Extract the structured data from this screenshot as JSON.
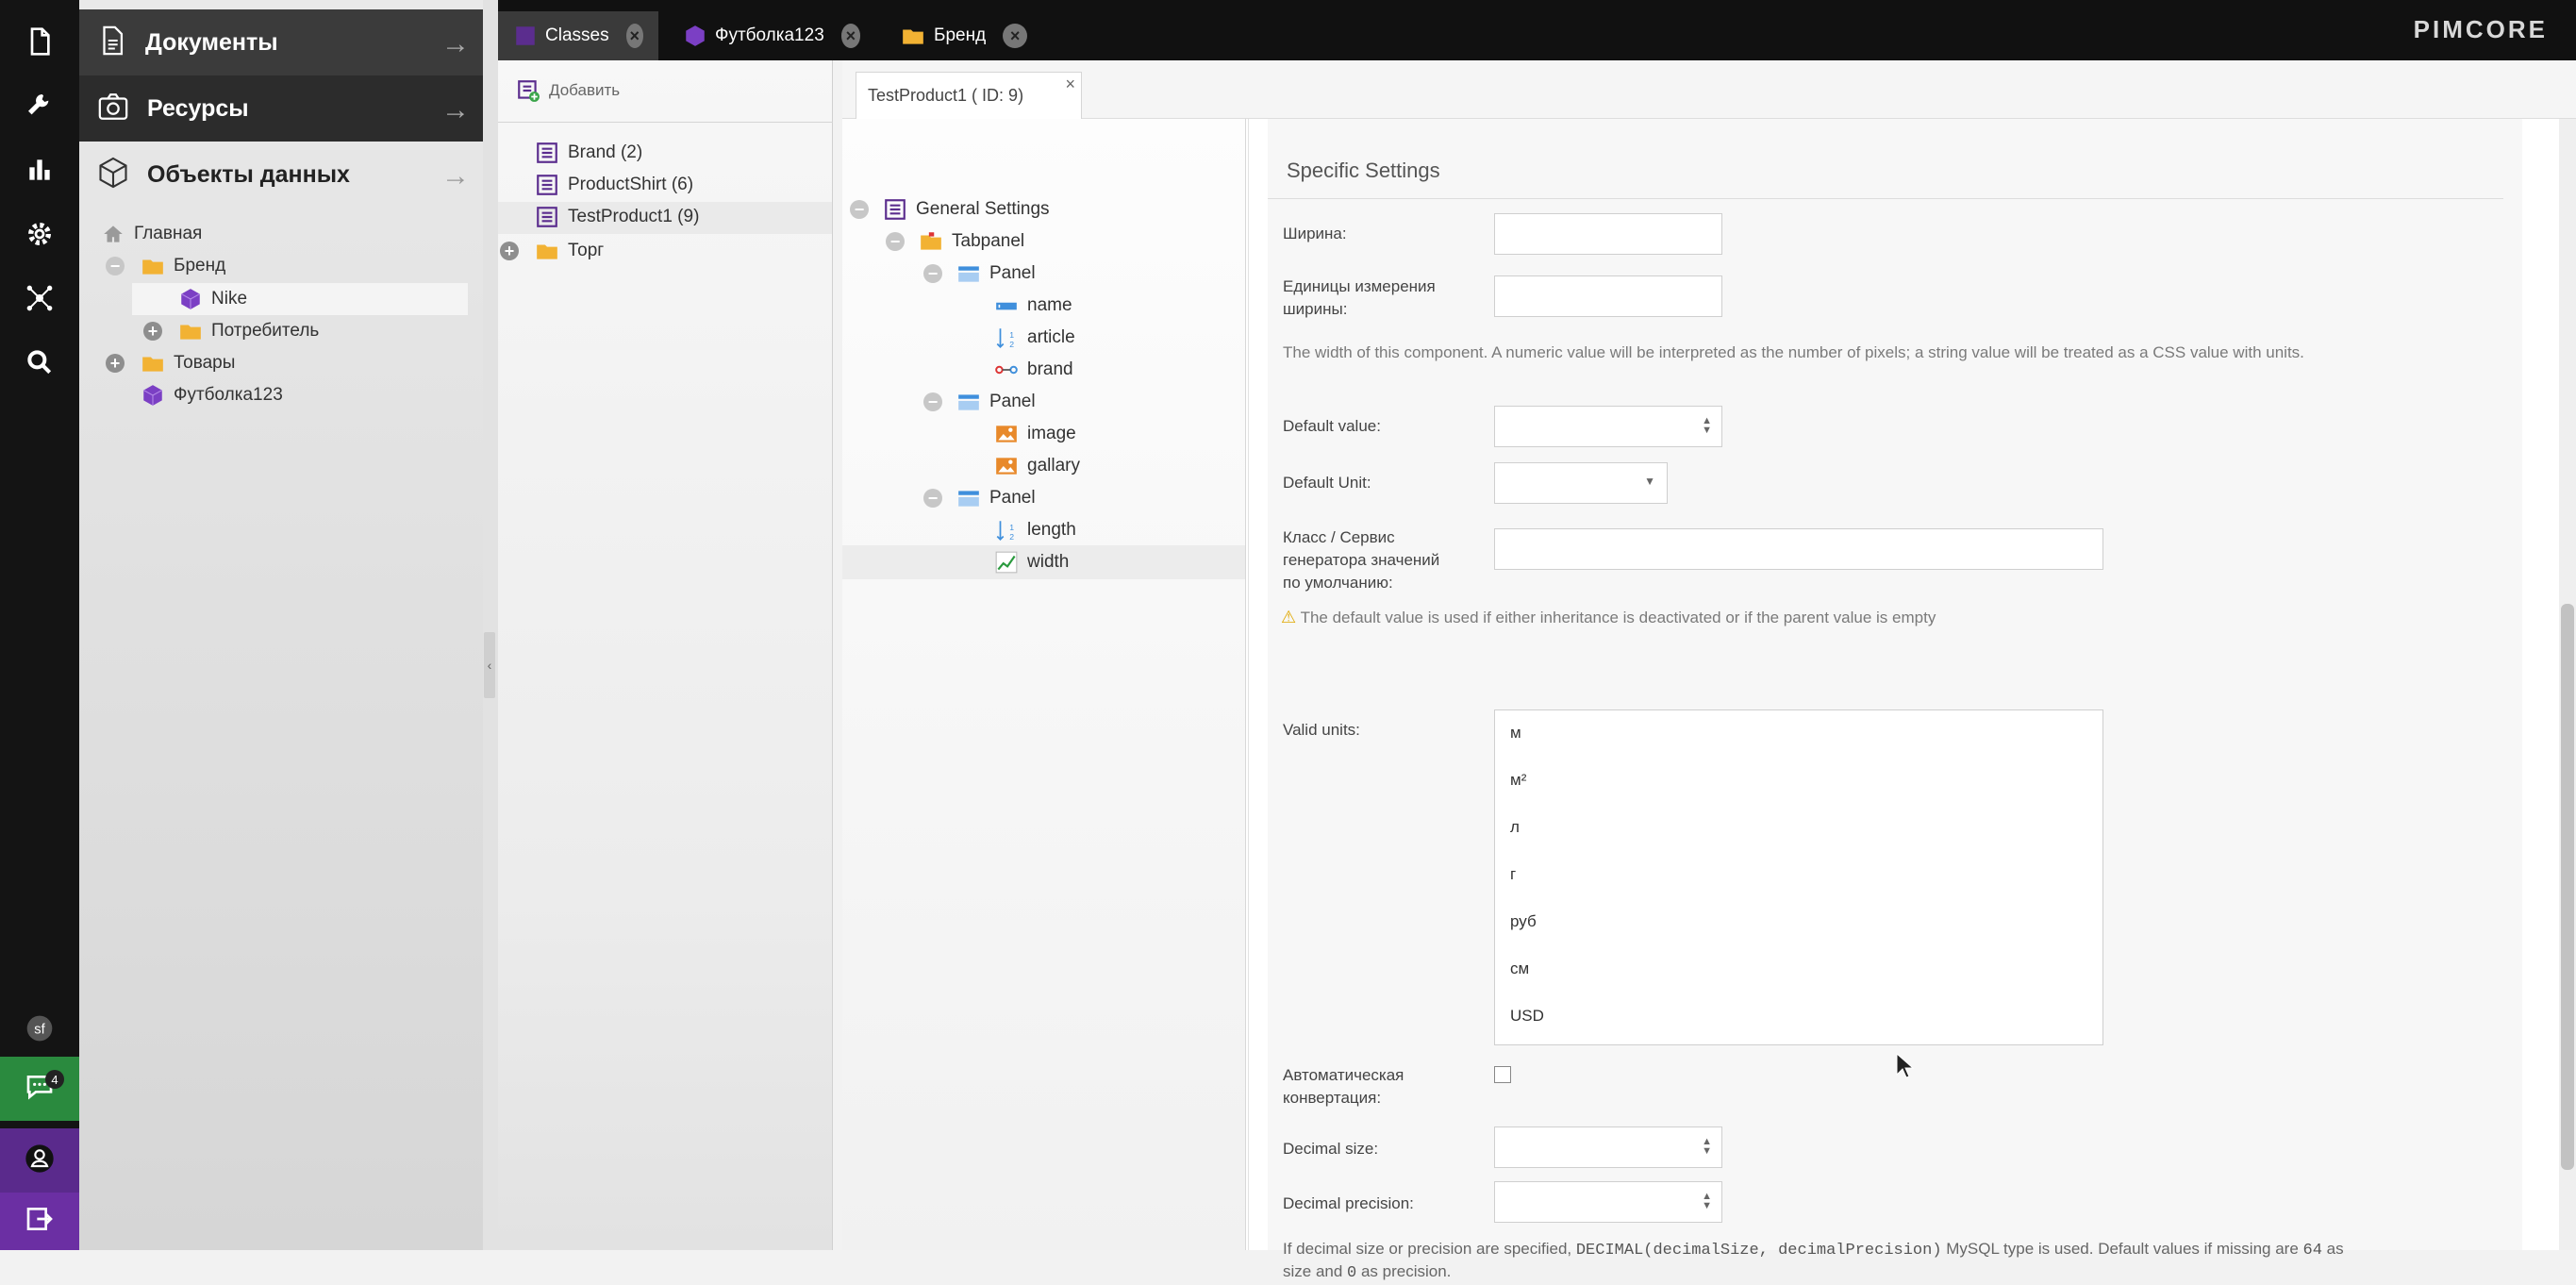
{
  "nav": {
    "documents": "Документы",
    "assets": "Ресурсы",
    "objects": "Объекты данных",
    "tree": [
      {
        "label": "Главная"
      },
      {
        "label": "Бренд"
      },
      {
        "label": "Nike"
      },
      {
        "label": "Потребитель"
      },
      {
        "label": "Товары"
      },
      {
        "label": "Футболка123"
      }
    ]
  },
  "rail": {
    "chat_badge": "4"
  },
  "tabs": [
    {
      "label": "Classes"
    },
    {
      "label": "Футболка123"
    },
    {
      "label": "Бренд"
    }
  ],
  "logo": "PIMCORE",
  "classes_panel": {
    "add_label": "Добавить",
    "items": [
      {
        "label": "Brand (2)"
      },
      {
        "label": "ProductShirt (6)"
      },
      {
        "label": "TestProduct1 (9)"
      },
      {
        "label": "Торг"
      }
    ]
  },
  "editor": {
    "tab_label": "TestProduct1 ( ID: 9)",
    "tree": [
      {
        "label": "General Settings"
      },
      {
        "label": "Tabpanel"
      },
      {
        "label": "Panel"
      },
      {
        "label": "name"
      },
      {
        "label": "article"
      },
      {
        "label": "brand"
      },
      {
        "label": "Panel"
      },
      {
        "label": "image"
      },
      {
        "label": "gallary"
      },
      {
        "label": "Panel"
      },
      {
        "label": "length"
      },
      {
        "label": "width"
      }
    ]
  },
  "settings": {
    "title": "Specific Settings",
    "width_label": "Ширина:",
    "width_unit_label_1": "Единицы измерения",
    "width_unit_label_2": "ширины:",
    "width_help": "The width of this component. A numeric value will be interpreted as the number of pixels; a string value will be treated as a CSS value with units.",
    "default_value_label": "Default value:",
    "default_unit_label": "Default Unit:",
    "generator_label_1": "Класс / Сервис",
    "generator_label_2": "генератора значений",
    "generator_label_3": "по умолчанию:",
    "default_warning": "The default value is used if either inheritance is deactivated or if the parent value is empty",
    "valid_units_label": "Valid units:",
    "valid_units": [
      "м",
      "м²",
      "л",
      "г",
      "руб",
      "см",
      "USD"
    ],
    "auto_convert_label_1": "Автоматическая",
    "auto_convert_label_2": "конвертация:",
    "auto_convert_checked": false,
    "decimal_size_label": "Decimal size:",
    "decimal_precision_label": "Decimal precision:",
    "decimal_help_1": "If decimal size or precision are specified, ",
    "decimal_help_code_1": "DECIMAL(decimalSize, decimalPrecision)",
    "decimal_help_2": " MySQL type is used. Default values if missing are ",
    "decimal_help_code_2": "64",
    "decimal_help_3": " as",
    "decimal_help_4": "size and ",
    "decimal_help_code_3": "0",
    "decimal_help_5": " as precision."
  },
  "colors": {
    "class_icon": "#5b2d8e",
    "folder": "#f2b233",
    "object_cube": "#7b3fc4",
    "panel_icon": "#3f8fdc",
    "image_icon": "#e8892a"
  }
}
